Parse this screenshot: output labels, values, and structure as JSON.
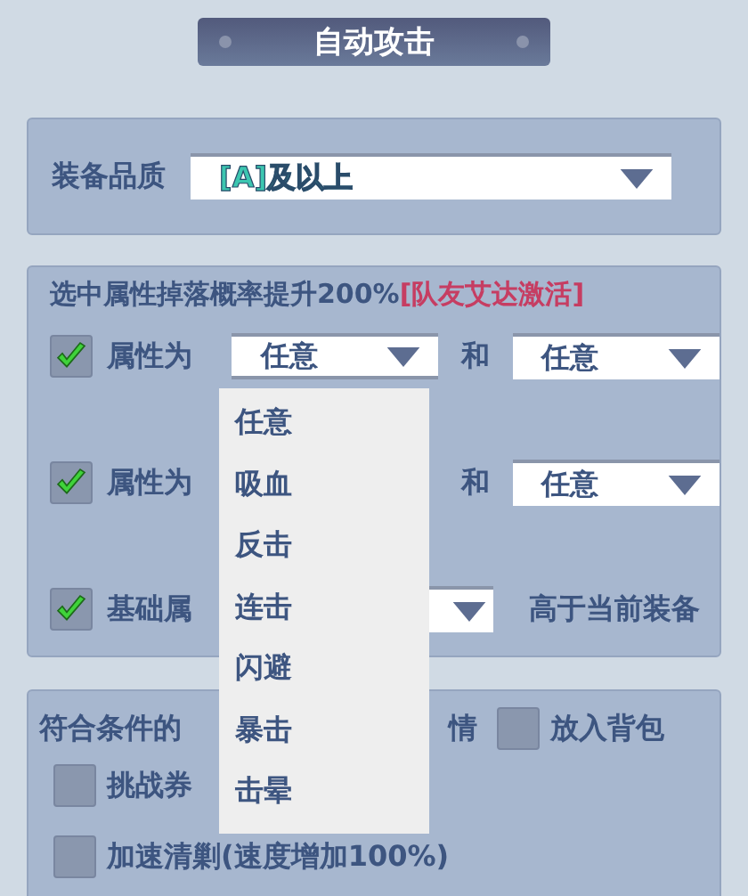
{
  "title": "自动攻击",
  "quality": {
    "label": "装备品质",
    "value": "[A]及以上"
  },
  "filter": {
    "heading": "选中属性掉落概率提升200%",
    "heading_highlight": "[队友艾达激活]",
    "rows": [
      {
        "kind": "pair",
        "checked": true,
        "label": "属性为",
        "first": {
          "value": "任意",
          "expanded": true
        },
        "joiner": "和",
        "second": {
          "value": "任意"
        }
      },
      {
        "kind": "pair",
        "checked": true,
        "label": "属性为",
        "joiner": "和",
        "second": {
          "value": "任意"
        }
      },
      {
        "kind": "base",
        "checked": true,
        "label": "基础属",
        "note": "高于当前装备"
      }
    ]
  },
  "menu": {
    "options": [
      {
        "label": "任意"
      },
      {
        "label": "吸血"
      },
      {
        "label": "反击"
      },
      {
        "label": "连击"
      },
      {
        "label": "闪避"
      },
      {
        "label": "暴击"
      },
      {
        "label": "击晕"
      }
    ]
  },
  "actions": {
    "detail_left": "符合条件的",
    "detail_right": "情",
    "bag": {
      "label": "放入背包",
      "checked": false
    },
    "options": [
      {
        "label": "挑战券",
        "checked": false
      },
      {
        "label": "加速清剿(速度增加100%)",
        "checked": false
      }
    ]
  }
}
